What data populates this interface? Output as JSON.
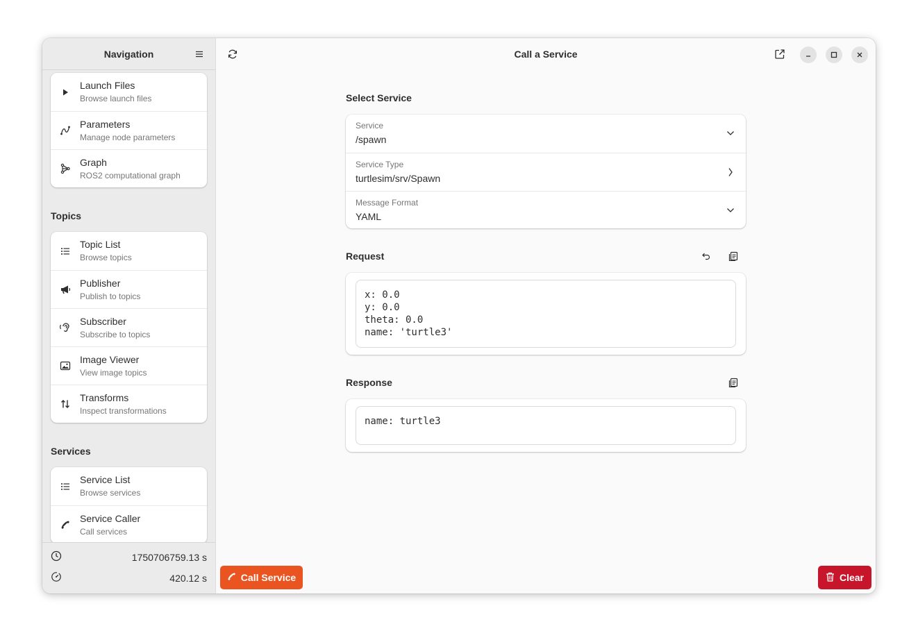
{
  "sidebar": {
    "title": "Navigation",
    "menu_icon": "hamburger-icon",
    "top_items": [
      {
        "label": "Launch Files",
        "sub": "Browse launch files",
        "icon": "play-icon"
      },
      {
        "label": "Parameters",
        "sub": "Manage node parameters",
        "icon": "curve-icon"
      },
      {
        "label": "Graph",
        "sub": "ROS2 computational graph",
        "icon": "graph-icon"
      }
    ],
    "topics": {
      "title": "Topics",
      "items": [
        {
          "label": "Topic List",
          "sub": "Browse topics",
          "icon": "list-icon"
        },
        {
          "label": "Publisher",
          "sub": "Publish to topics",
          "icon": "megaphone-icon"
        },
        {
          "label": "Subscriber",
          "sub": "Subscribe to topics",
          "icon": "ear-icon"
        },
        {
          "label": "Image Viewer",
          "sub": "View image topics",
          "icon": "image-icon"
        },
        {
          "label": "Transforms",
          "sub": "Inspect transformations",
          "icon": "arrows-icon"
        }
      ]
    },
    "services": {
      "title": "Services",
      "items": [
        {
          "label": "Service List",
          "sub": "Browse services",
          "icon": "list-icon"
        },
        {
          "label": "Service Caller",
          "sub": "Call services",
          "icon": "phone-icon"
        }
      ]
    },
    "footer": {
      "clock_value": "1750706759.13 s",
      "uptime_value": "420.12 s"
    }
  },
  "main": {
    "title": "Call a Service",
    "select_service": {
      "title": "Select Service",
      "service_label": "Service",
      "service_value": "/spawn",
      "type_label": "Service Type",
      "type_value": "turtlesim/srv/Spawn",
      "format_label": "Message Format",
      "format_value": "YAML"
    },
    "request": {
      "title": "Request",
      "body": "x: 0.0\ny: 0.0\ntheta: 0.0\nname: 'turtle3'"
    },
    "response": {
      "title": "Response",
      "body": "name: turtle3"
    },
    "call_button": "Call Service",
    "clear_button": "Clear"
  },
  "colors": {
    "accent": "#e95420",
    "destructive": "#c7162b"
  }
}
